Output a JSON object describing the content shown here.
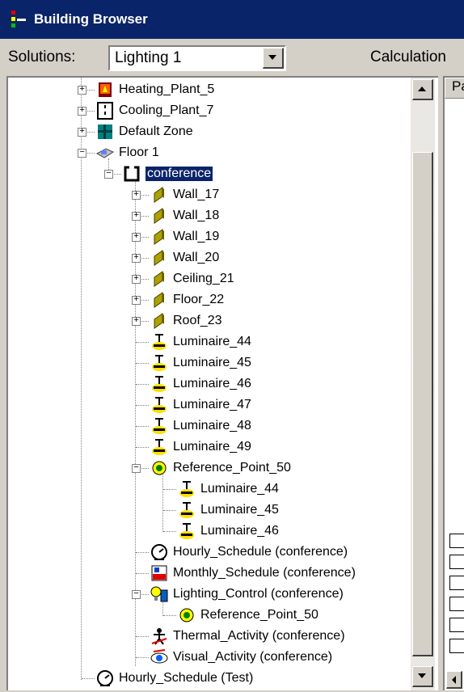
{
  "window": {
    "title": "Building Browser"
  },
  "toolbar": {
    "solutions_label": "Solutions:",
    "solution_value": "Lighting 1",
    "calculation_label": "Calculation"
  },
  "right_panel": {
    "column_header": "Pa"
  },
  "tree": {
    "items": [
      {
        "label": "Heating_Plant_5",
        "icon": "heating-plant-icon",
        "selected": false
      },
      {
        "label": "Cooling_Plant_7",
        "icon": "cooling-plant-icon",
        "selected": false
      },
      {
        "label": "Default Zone",
        "icon": "zone-icon",
        "selected": false
      },
      {
        "label": "Floor 1",
        "icon": "floor-icon",
        "selected": false
      },
      {
        "label": "conference",
        "icon": "room-icon",
        "selected": true
      },
      {
        "label": "Wall_17",
        "icon": "wall-icon",
        "selected": false
      },
      {
        "label": "Wall_18",
        "icon": "wall-icon",
        "selected": false
      },
      {
        "label": "Wall_19",
        "icon": "wall-icon",
        "selected": false
      },
      {
        "label": "Wall_20",
        "icon": "wall-icon",
        "selected": false
      },
      {
        "label": "Ceiling_21",
        "icon": "wall-icon",
        "selected": false
      },
      {
        "label": "Floor_22",
        "icon": "wall-icon",
        "selected": false
      },
      {
        "label": "Roof_23",
        "icon": "wall-icon",
        "selected": false
      },
      {
        "label": "Luminaire_44",
        "icon": "luminaire-icon",
        "selected": false
      },
      {
        "label": "Luminaire_45",
        "icon": "luminaire-icon",
        "selected": false
      },
      {
        "label": "Luminaire_46",
        "icon": "luminaire-icon",
        "selected": false
      },
      {
        "label": "Luminaire_47",
        "icon": "luminaire-icon",
        "selected": false
      },
      {
        "label": "Luminaire_48",
        "icon": "luminaire-icon",
        "selected": false
      },
      {
        "label": "Luminaire_49",
        "icon": "luminaire-icon",
        "selected": false
      },
      {
        "label": "Reference_Point_50",
        "icon": "reference-point-icon",
        "selected": false
      },
      {
        "label": "Luminaire_44",
        "icon": "luminaire-icon",
        "selected": false
      },
      {
        "label": "Luminaire_45",
        "icon": "luminaire-icon",
        "selected": false
      },
      {
        "label": "Luminaire_46",
        "icon": "luminaire-icon",
        "selected": false
      },
      {
        "label": "Hourly_Schedule (conference)",
        "icon": "clock-icon",
        "selected": false
      },
      {
        "label": "Monthly_Schedule (conference)",
        "icon": "calendar-icon",
        "selected": false
      },
      {
        "label": "Lighting_Control (conference)",
        "icon": "lighting-control-icon",
        "selected": false
      },
      {
        "label": "Reference_Point_50",
        "icon": "reference-point-icon",
        "selected": false
      },
      {
        "label": "Thermal_Activity (conference)",
        "icon": "thermal-activity-icon",
        "selected": false
      },
      {
        "label": "Visual_Activity (conference)",
        "icon": "visual-activity-icon",
        "selected": false
      },
      {
        "label": "Hourly_Schedule (Test)",
        "icon": "clock-icon",
        "selected": false
      }
    ]
  },
  "colors": {
    "titlebar": "#0a246a",
    "selection": "#0a246a",
    "face": "#d4d0c8"
  }
}
